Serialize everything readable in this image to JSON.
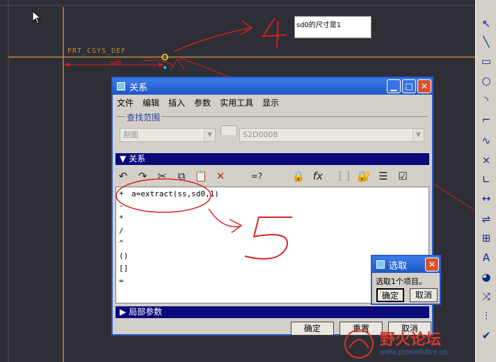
{
  "canvas": {
    "csys_label": "PRT_CSYS_DEF",
    "dim_label": "sd0",
    "note_text": "sd0的尺寸是1",
    "annotation_4": "4",
    "annotation_5": "5"
  },
  "toolbar_icons": [
    "select-arrow-icon",
    "line-icon",
    "rectangle-icon",
    "circle-icon",
    "arc-icon",
    "fillet-icon",
    "spline-icon",
    "point-icon",
    "centerline-icon",
    "dimension-icon",
    "modify-icon",
    "constraint-icon",
    "text-icon",
    "palette-icon",
    "trim-icon",
    "mirror-icon",
    "check-icon"
  ],
  "relations_dialog": {
    "title": "关系",
    "menus": [
      "文件",
      "编辑",
      "插入",
      "参数",
      "实用工具",
      "显示"
    ],
    "lookup_group": "查找范围",
    "lookup_type": "剖面",
    "lookup_name": "S2D0008",
    "section_relations": "关系",
    "eval_label": "=?",
    "code_text": "a=extract(ss,sd0,1)",
    "operators": [
      "+",
      "-",
      "*",
      "/",
      "^",
      "()",
      "[]",
      "="
    ],
    "section_local_params": "局部参数",
    "ok_label": "确定",
    "reset_label": "重置",
    "cancel_label": "取消"
  },
  "select_dialog": {
    "title": "选取",
    "message": "选取1个项目。",
    "ok_label": "确定",
    "cancel_label": "取消"
  },
  "watermark": {
    "text": "野火论坛",
    "url": "www.proewildfire.cn"
  },
  "colors": {
    "titlebar": "#1f57c7",
    "section_header": "#0a0a7a",
    "annotation_red": "#d42020",
    "csys_orange": "#c08a3a"
  }
}
